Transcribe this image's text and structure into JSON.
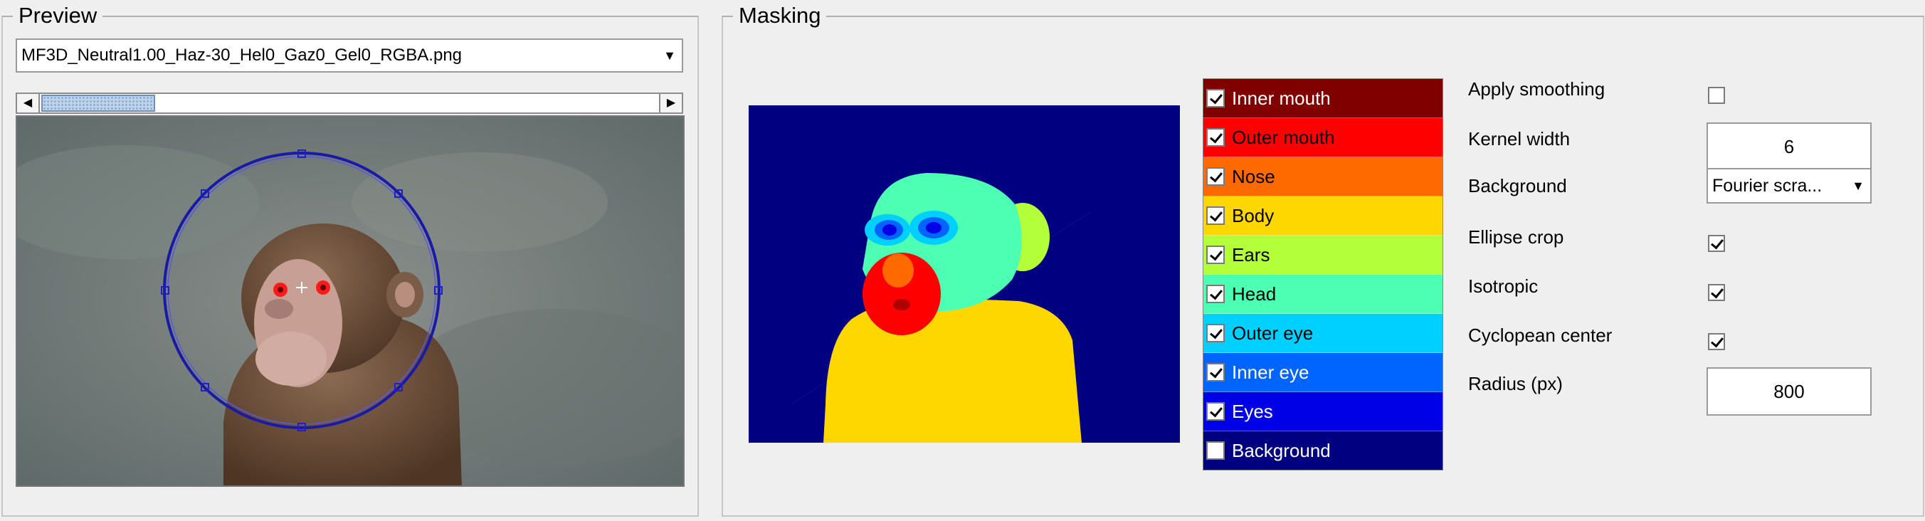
{
  "preview": {
    "title": "Preview",
    "file_selected": "MF3D_Neutral1.00_Haz-30_Hel0_Gaz0_Gel0_RGBA.png"
  },
  "masking": {
    "title": "Masking",
    "legend": [
      {
        "label": "Inner mouth",
        "color": "#800000",
        "checked": true
      },
      {
        "label": "Outer mouth",
        "color": "#ff0000",
        "checked": true
      },
      {
        "label": "Nose",
        "color": "#ff6a00",
        "checked": true
      },
      {
        "label": "Body",
        "color": "#ffd700",
        "checked": true
      },
      {
        "label": "Ears",
        "color": "#b2ff3a",
        "checked": true
      },
      {
        "label": "Head",
        "color": "#4dffb3",
        "checked": true
      },
      {
        "label": "Outer eye",
        "color": "#00d0ff",
        "checked": true
      },
      {
        "label": "Inner eye",
        "color": "#0064ff",
        "checked": true
      },
      {
        "label": "Eyes",
        "color": "#0000e6",
        "checked": true
      },
      {
        "label": "Background",
        "color": "#000080",
        "checked": false
      }
    ],
    "options": {
      "apply_smoothing_label": "Apply smoothing",
      "apply_smoothing_checked": false,
      "kernel_width_label": "Kernel width",
      "kernel_width_value": "6",
      "background_label": "Background",
      "background_value": "Fourier scra...",
      "ellipse_crop_label": "Ellipse crop",
      "ellipse_crop_checked": true,
      "isotropic_label": "Isotropic",
      "isotropic_checked": true,
      "cyclopean_center_label": "Cyclopean center",
      "cyclopean_center_checked": true,
      "radius_label": "Radius (px)",
      "radius_value": "800"
    }
  }
}
